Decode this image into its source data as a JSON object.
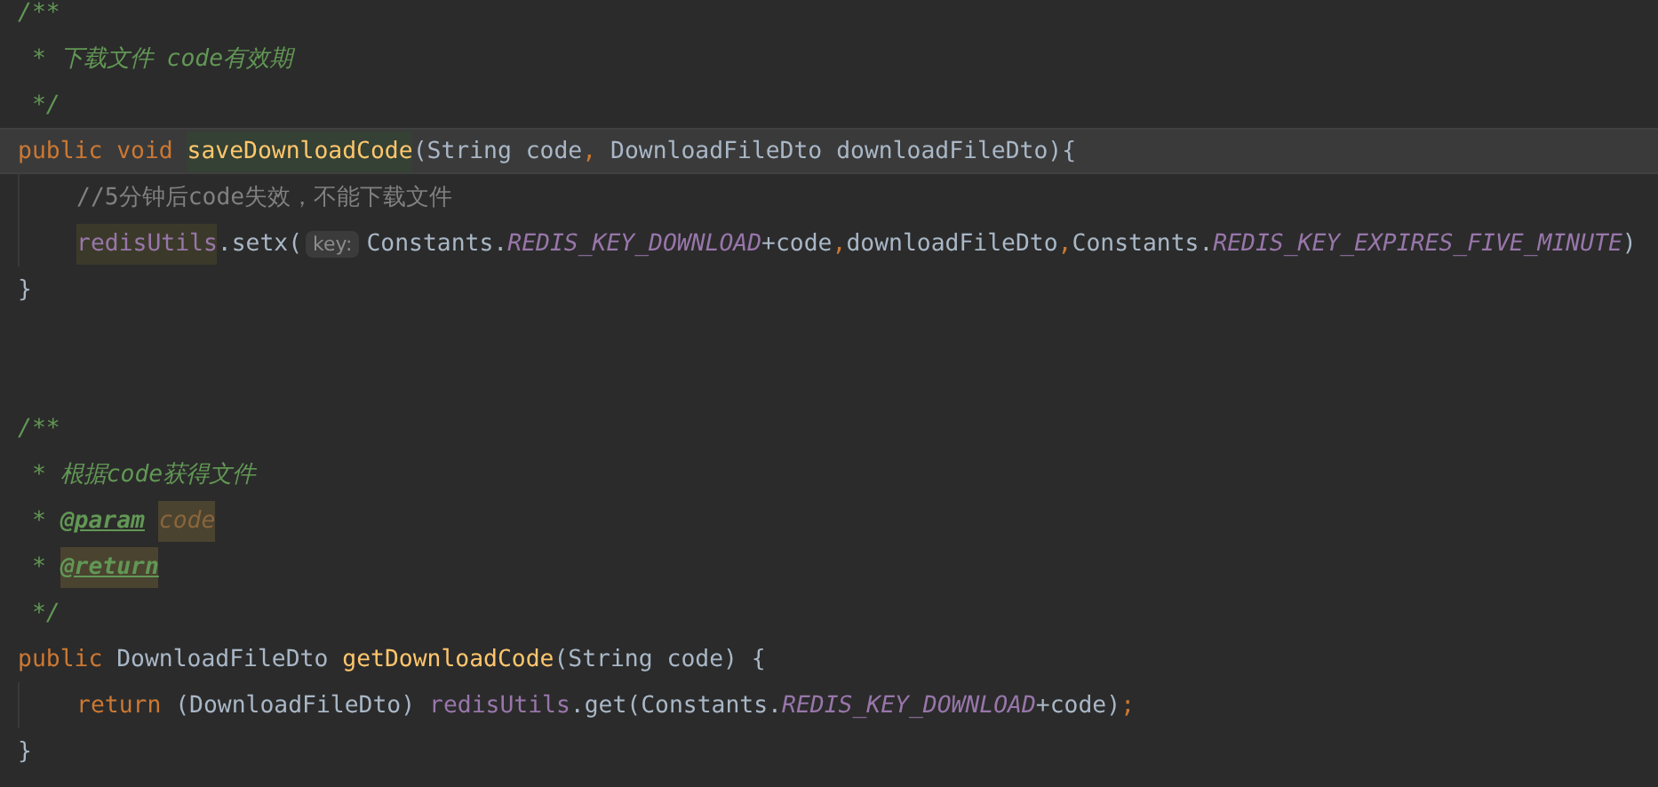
{
  "editor": {
    "lines": [
      {
        "selected": false,
        "tokens": [
          {
            "text": "/**",
            "kind": "doc"
          }
        ]
      },
      {
        "selected": false,
        "tokens": [
          {
            "text": " * 下载文件 code有效期",
            "kind": "doc"
          }
        ]
      },
      {
        "selected": false,
        "tokens": [
          {
            "text": " */",
            "kind": "doc"
          }
        ]
      },
      {
        "selected": true,
        "tokens": [
          {
            "text": "public void ",
            "kind": "keyword"
          },
          {
            "text": "saveDownloadCode",
            "kind": "method_decl_hl"
          },
          {
            "text": "(",
            "kind": "plain"
          },
          {
            "text": "String ",
            "kind": "type"
          },
          {
            "text": "code",
            "kind": "param"
          },
          {
            "text": ", ",
            "kind": "punct"
          },
          {
            "text": "DownloadFileDto ",
            "kind": "type"
          },
          {
            "text": "downloadFileDto",
            "kind": "param"
          },
          {
            "text": "){",
            "kind": "plain"
          }
        ],
        "children": [
          {
            "selected": false,
            "tokens": [
              {
                "text": "//5分钟后code失效，不能下载文件",
                "kind": "line_comment"
              }
            ]
          },
          {
            "selected": false,
            "tokens": [
              {
                "text": "redisUtils",
                "kind": "field_hl"
              },
              {
                "text": ".setx(",
                "kind": "plain"
              },
              {
                "text": "key:",
                "kind": "inlay_hint"
              },
              {
                "text": "Constants.",
                "kind": "plain"
              },
              {
                "text": "REDIS_KEY_DOWNLOAD",
                "kind": "constant"
              },
              {
                "text": "+code",
                "kind": "plain"
              },
              {
                "text": ",",
                "kind": "punct"
              },
              {
                "text": "downloadFileDto",
                "kind": "plain"
              },
              {
                "text": ",",
                "kind": "punct"
              },
              {
                "text": "Constants.",
                "kind": "plain"
              },
              {
                "text": "REDIS_KEY_EXPIRES_FIVE_MINUTE",
                "kind": "constant"
              },
              {
                "text": ")",
                "kind": "plain"
              }
            ]
          }
        ]
      },
      {
        "selected": false,
        "tokens": [
          {
            "text": "}",
            "kind": "plain"
          }
        ]
      },
      {
        "selected": false
      },
      {
        "selected": false
      },
      {
        "selected": false,
        "tokens": [
          {
            "text": "/**",
            "kind": "doc"
          }
        ]
      },
      {
        "selected": false,
        "tokens": [
          {
            "text": " * 根据code获得文件",
            "kind": "doc"
          }
        ]
      },
      {
        "selected": false,
        "tokens": [
          {
            "text": " * ",
            "kind": "doc"
          },
          {
            "text": "@param",
            "kind": "doc_tag"
          },
          {
            "text": "code",
            "kind": "doc_param_hl"
          }
        ]
      },
      {
        "selected": false,
        "tokens": [
          {
            "text": " * ",
            "kind": "doc"
          },
          {
            "text": "@return",
            "kind": "doc_tag_hl"
          }
        ]
      },
      {
        "selected": false,
        "tokens": [
          {
            "text": " */",
            "kind": "doc"
          }
        ]
      },
      {
        "selected": false,
        "tokens": [
          {
            "text": "public ",
            "kind": "keyword"
          },
          {
            "text": "DownloadFileDto ",
            "kind": "type"
          },
          {
            "text": "getDownloadCode",
            "kind": "method_decl"
          },
          {
            "text": "(",
            "kind": "plain"
          },
          {
            "text": "String ",
            "kind": "type"
          },
          {
            "text": "code",
            "kind": "param"
          },
          {
            "text": ") {",
            "kind": "plain"
          }
        ],
        "children": [
          {
            "selected": false,
            "tokens": [
              {
                "text": "return ",
                "kind": "keyword"
              },
              {
                "text": "(DownloadFileDto) ",
                "kind": "plain"
              },
              {
                "text": "redisUtils",
                "kind": "field"
              },
              {
                "text": ".get(Constants.",
                "kind": "plain"
              },
              {
                "text": "REDIS_KEY_DOWNLOAD",
                "kind": "constant"
              },
              {
                "text": "+code)",
                "kind": "plain"
              },
              {
                "text": ";",
                "kind": "punct"
              }
            ]
          }
        ]
      },
      {
        "selected": false,
        "tokens": [
          {
            "text": "}",
            "kind": "plain"
          }
        ]
      }
    ]
  }
}
